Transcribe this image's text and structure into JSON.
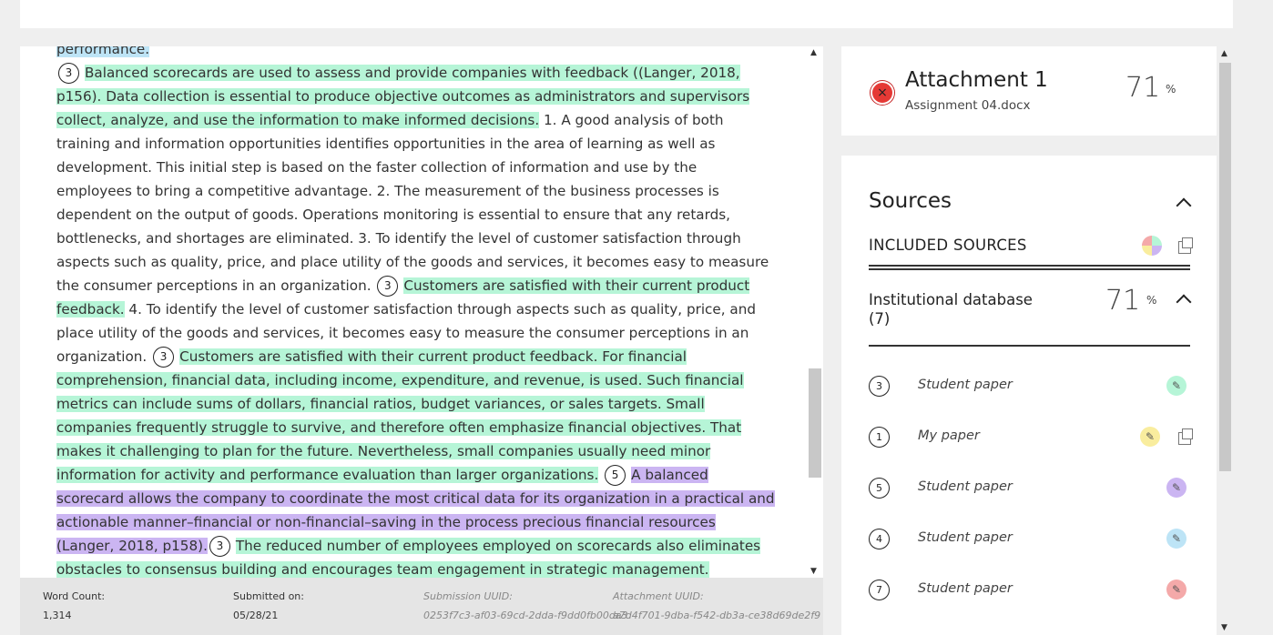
{
  "document": {
    "lines_before": "performance.",
    "segments": [
      {
        "type": "num",
        "value": "3"
      },
      {
        "type": "text",
        "hl": "green",
        "value": "Balanced scorecards are used to assess and provide companies with feedback ((Langer, 2018, p156). Data collection is essential to produce objective outcomes as administrators and supervisors collect, analyze, and use the information to make informed decisions."
      },
      {
        "type": "text",
        "hl": "",
        "value": " 1. A good analysis of both training and information opportunities identifies opportunities in the area of learning as well as development. This initial step is based on the faster collection of information and use by the employees to bring a competitive advantage. 2. The measurement of the business processes is dependent on the output of goods. Operations monitoring is essential to ensure that any retards, bottlenecks, and shortages are eliminated. 3. To identify the level of customer satisfaction through aspects such as quality, price, and place utility of the goods and services, it becomes easy to measure the consumer perceptions in an organization. "
      },
      {
        "type": "num",
        "value": "3"
      },
      {
        "type": "text",
        "hl": "green",
        "value": "Customers are satisfied with their current product feedback."
      },
      {
        "type": "text",
        "hl": "",
        "value": " 4. To identify the level of customer satisfaction through aspects such as quality, price, and place utility of the goods and services, it becomes easy to measure the consumer perceptions in an organization. "
      },
      {
        "type": "num",
        "value": "3"
      },
      {
        "type": "text",
        "hl": "green",
        "value": "Customers are satisfied with their current product feedback. For financial comprehension, financial data, including income, expenditure, and revenue, is used. Such financial metrics can include sums of dollars, financial ratios, budget variances, or sales targets. Small companies frequently struggle to survive, and therefore often emphasize financial objectives. That makes it challenging to plan for the future. Nevertheless, small companies usually need minor information for activity and performance evaluation than larger organizations."
      },
      {
        "type": "text",
        "hl": "",
        "value": " "
      },
      {
        "type": "num",
        "value": "5"
      },
      {
        "type": "text",
        "hl": "purple",
        "value": "A balanced scorecard allows the company to coordinate the most critical data for its organization in a practical and actionable manner–financial or non-financial–saving in the process precious financial resources (Langer, 2018, p158)."
      },
      {
        "type": "num",
        "value": "3"
      },
      {
        "type": "text",
        "hl": "green",
        "value": "The reduced number of employees employed on scorecards also eliminates obstacles to consensus building and encourages team engagement in strategic management. Customer satisfaction is at the core of empowered and productive workers. Individual scorecards turn the scorecard into"
      }
    ]
  },
  "footer": {
    "word_count_label": "Word Count:",
    "word_count": "1,314",
    "submitted_label": "Submitted on:",
    "submitted": "05/28/21",
    "submission_uuid_label": "Submission UUID:",
    "submission_uuid": "0253f7c3-af03-69cd-2dda-f9dd0fb00da3",
    "attachment_uuid_label": "Attachment UUID:",
    "attachment_uuid": "a7d4f701-9dba-f542-db3a-ce38d69de2f9"
  },
  "attachment": {
    "title": "Attachment 1",
    "filename": "Assignment 04.docx",
    "percent": "71",
    "percent_sign": "%"
  },
  "sources": {
    "title": "Sources",
    "included_title": "INCLUDED SOURCES",
    "database_title": "Institutional database (7)",
    "database_percent": "71",
    "percent_sign": "%",
    "items": [
      {
        "num": "3",
        "name": "Student paper",
        "color": "#b6f5d7",
        "external": false
      },
      {
        "num": "1",
        "name": "My paper",
        "color": "#f9ed9e",
        "external": true
      },
      {
        "num": "5",
        "name": "Student paper",
        "color": "#cbb5f2",
        "external": false
      },
      {
        "num": "4",
        "name": "Student paper",
        "color": "#bde4f6",
        "external": false
      },
      {
        "num": "7",
        "name": "Student paper",
        "color": "#f4a9a9",
        "external": false
      }
    ]
  },
  "icons": {
    "close": "×",
    "highlighter": "✎",
    "scroll_up": "▲",
    "scroll_down": "▼"
  }
}
